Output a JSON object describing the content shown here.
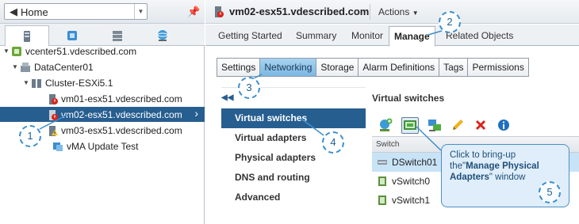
{
  "home": {
    "label": "Home"
  },
  "nav_tabs": [
    {
      "icon": "hosts-clusters-icon"
    },
    {
      "icon": "vms-templates-icon"
    },
    {
      "icon": "storage-icon"
    },
    {
      "icon": "networking-icon"
    }
  ],
  "tree": [
    {
      "label": "vcenter51.vdescribed.com"
    },
    {
      "label": "DataCenter01"
    },
    {
      "label": "Cluster-ESXi5.1"
    },
    {
      "label": "vm01-esx51.vdescribed.com"
    },
    {
      "label": "vm02-esx51.vdescribed.com"
    },
    {
      "label": "vm03-esx51.vdescribed.com"
    },
    {
      "label": "vMA Update Test"
    }
  ],
  "header": {
    "title": "vm02-esx51.vdescribed.com",
    "actions": "Actions"
  },
  "main_tabs": [
    "Getting Started",
    "Summary",
    "Monitor",
    "Manage",
    "Related Objects"
  ],
  "sub_tabs": [
    "Settings",
    "Networking",
    "Storage",
    "Alarm Definitions",
    "Tags",
    "Permissions"
  ],
  "side_menu": [
    "Virtual switches",
    "Virtual adapters",
    "Physical adapters",
    "DNS and routing",
    "Advanced"
  ],
  "content": {
    "title": "Virtual switches",
    "column_header": "Switch",
    "switches": [
      "DSwitch01",
      "vSwitch0",
      "vSwitch1"
    ]
  },
  "callouts": [
    "1",
    "2",
    "3",
    "4",
    "5"
  ],
  "tooltip": {
    "line1": "Click to bring-up",
    "line2_pre": "the\"",
    "line2_bold": "Manage Physical",
    "line3_bold": "Adapters",
    "line3_post": "\" window"
  },
  "colors": {
    "selection": "#275e90",
    "accent": "#3a8ecf",
    "tab_active": "#7ab8e4"
  }
}
